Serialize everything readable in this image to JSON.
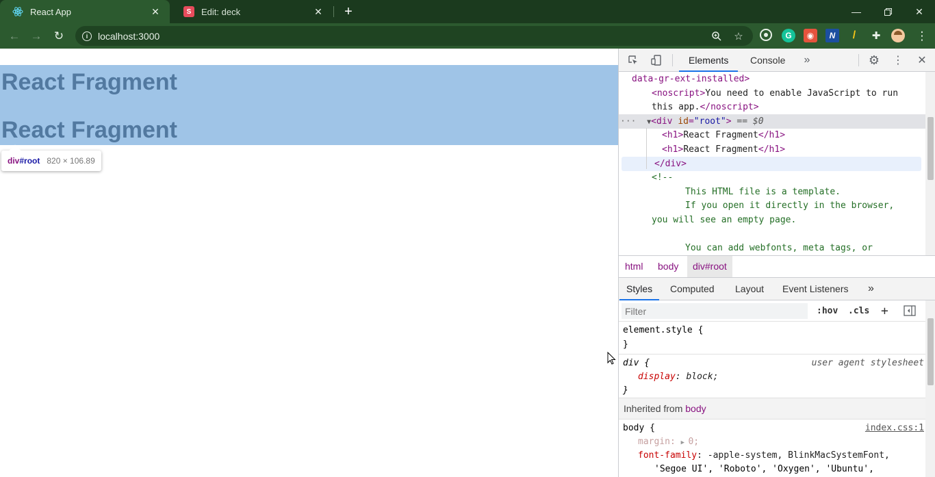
{
  "browser": {
    "tabs": [
      {
        "title": "React App",
        "favicon": "react-icon",
        "active": true
      },
      {
        "title": "Edit: deck",
        "favicon": "s-letter-icon",
        "favicon_letter": "S",
        "active": false
      }
    ],
    "url": "localhost:3000",
    "accent": "#2c5a2f",
    "tabstrip_color": "#1b3a1e"
  },
  "page": {
    "headings": [
      "React Fragment",
      "React Fragment"
    ],
    "highlight_color": "#9fc4e7",
    "tooltip": {
      "tag": "div",
      "id": "#root",
      "dims": "820 × 106.89"
    }
  },
  "devtools": {
    "tabs": [
      "Elements",
      "Console"
    ],
    "active_tab": "Elements",
    "dom_lines": {
      "l1": "data-gr-ext-installed>",
      "l2_open": "<noscript>",
      "l2_text": "You need to enable JavaScript to run",
      "l3_text": "this app.",
      "l3_close": "</noscript>",
      "l4_tag_open": "<div",
      "l4_attr": "id",
      "l4_val": "\"root\"",
      "l4_close": ">",
      "l4_eq": " == ",
      "l4_dollar": "$0",
      "l5_open": "<h1>",
      "l5_text": "React Fragment",
      "l5_close": "</h1>",
      "l6_open": "<h1>",
      "l6_text": "React Fragment",
      "l6_close": "</h1>",
      "l7": "</div>",
      "l8": "<!--",
      "l9": "This HTML file is a template.",
      "l10": "If you open it directly in the browser,",
      "l11": "you will see an empty page.",
      "l12": "You can add webfonts, meta tags, or"
    },
    "breadcrumbs": [
      "html",
      "body",
      "div#root"
    ],
    "styles_tabs": [
      "Styles",
      "Computed",
      "Layout",
      "Event Listeners"
    ],
    "filter_placeholder": "Filter",
    "hov_label": ":hov",
    "cls_label": ".cls",
    "rules": {
      "element_style_open": "element.style {",
      "element_style_close": "}",
      "div_selector": "div",
      "div_brace": " {",
      "div_source": "user agent stylesheet",
      "div_prop": "display",
      "div_val": "block;",
      "div_close": "}",
      "inherited_label": "Inherited from ",
      "inherited_from": "body",
      "body_selector": "body {",
      "body_source": "index.css:1",
      "margin_prop": "margin",
      "margin_val": "0;",
      "font_prop": "font-family",
      "font_val": "-apple-system, BlinkMacSystemFont,",
      "font_val2": "'Segoe UI', 'Roboto', 'Oxygen', 'Ubuntu',"
    }
  }
}
